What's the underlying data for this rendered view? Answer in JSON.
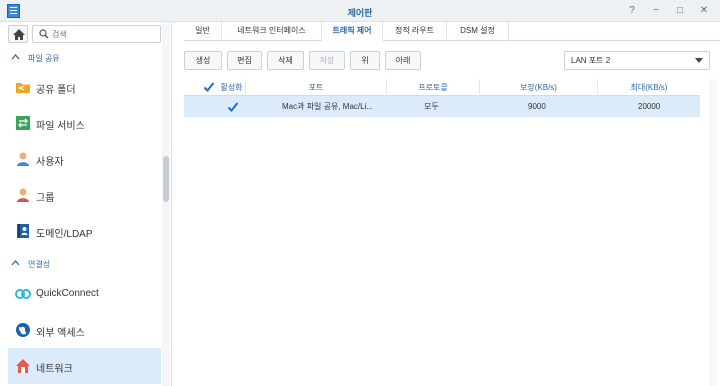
{
  "window": {
    "title": "제어판",
    "controls": [
      "?",
      "−",
      "□",
      "✕"
    ]
  },
  "sidebar": {
    "search": {
      "placeholder": "검색"
    },
    "sections": [
      {
        "label": "파일 공유",
        "items": [
          {
            "label": "공유 폴더",
            "icon": "shared-folder-icon"
          },
          {
            "label": "파일 서비스",
            "icon": "file-services-icon"
          },
          {
            "label": "사용자",
            "icon": "user-icon"
          },
          {
            "label": "그룹",
            "icon": "group-icon"
          },
          {
            "label": "도메인/LDAP",
            "icon": "domain-ldap-icon"
          }
        ]
      },
      {
        "label": "연결성",
        "items": [
          {
            "label": "QuickConnect",
            "icon": "quickconnect-icon"
          },
          {
            "label": "외부 액세스",
            "icon": "external-access-icon"
          },
          {
            "label": "네트워크",
            "icon": "network-icon",
            "active": true
          }
        ]
      }
    ]
  },
  "tabs": [
    "일반",
    "네트워크 인터페이스",
    "트래픽 제어",
    "정적 라우트",
    "DSM 설정"
  ],
  "active_tab": "트래픽 제어",
  "toolbar": {
    "create": "생성",
    "edit": "편집",
    "delete": "삭제",
    "save": "저장",
    "up": "위",
    "down": "아래",
    "interface_select": "LAN 포트 2"
  },
  "table": {
    "headers": {
      "enabled": "활성화됨",
      "port": "포트",
      "protocol": "프로토콜",
      "guaranteed": "보장(KB/s)",
      "max": "최대(KB/s)"
    },
    "rows": [
      {
        "enabled": true,
        "port": "Mac과 파일 공유, Mac/Li...",
        "protocol": "모두",
        "guaranteed": "9000",
        "max": "20000"
      }
    ]
  },
  "colors": {
    "accent": "#2c6aa6",
    "selected_row": "#dcebf9",
    "check": "#1f6fc4"
  }
}
